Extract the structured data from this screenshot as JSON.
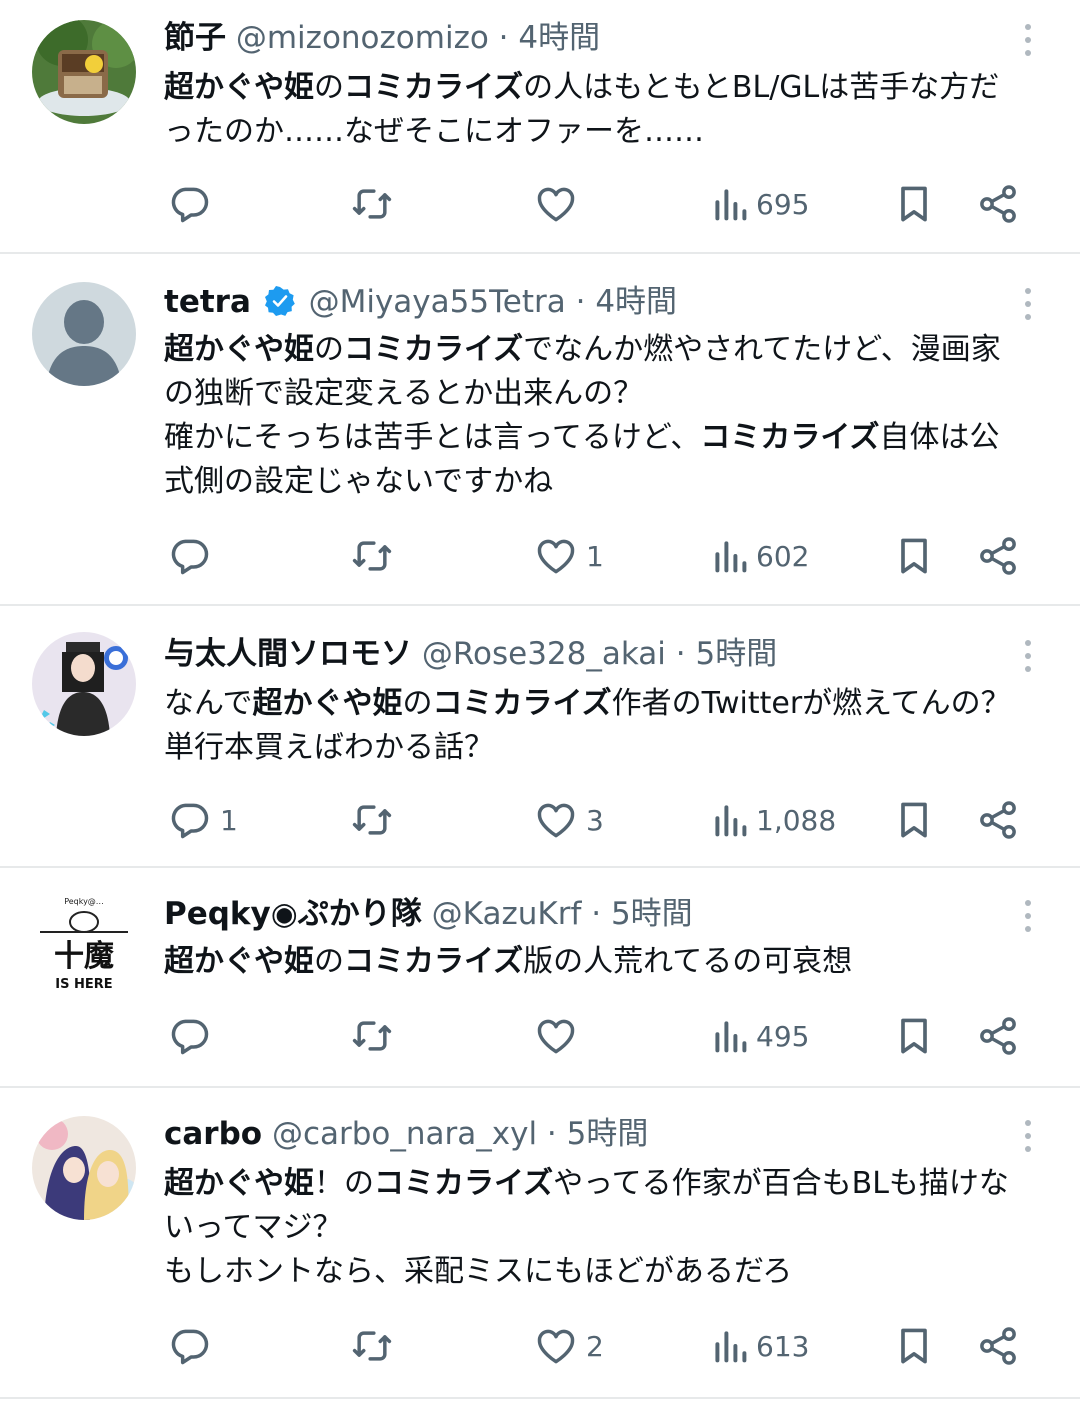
{
  "tweets": [
    {
      "name": "節子",
      "handle": "@mizonozomizo",
      "sep": "·",
      "time": "4時間",
      "lines": [
        [
          {
            "b": "超かぐや姫"
          },
          {
            "t": "の"
          },
          {
            "b": "コミカライズ"
          },
          {
            "t": "の人はもともとBL/GLは苦手な方だ"
          }
        ],
        [
          {
            "t": "ったのか……なぜそこにオファーを……"
          }
        ]
      ],
      "replies": "",
      "retweets": "",
      "likes": "",
      "views": "695"
    },
    {
      "name": "tetra",
      "verified": true,
      "handle": "@Miyaya55Tetra",
      "sep": "·",
      "time": "4時間",
      "lines": [
        [
          {
            "b": "超かぐや姫"
          },
          {
            "t": "の"
          },
          {
            "b": "コミカライズ"
          },
          {
            "t": "でなんか燃やされてたけど、漫画家"
          }
        ],
        [
          {
            "t": "の独断で設定変えるとか出来んの？"
          }
        ],
        [
          {
            "t": "確かにそっちは苦手とは言ってるけど、"
          },
          {
            "b": "コミカライズ"
          },
          {
            "t": "自体は公"
          }
        ],
        [
          {
            "t": "式側の設定じゃないですかね"
          }
        ]
      ],
      "replies": "",
      "retweets": "",
      "likes": "1",
      "views": "602"
    },
    {
      "name": "与太人間ソロモソ",
      "handle": "@Rose328_akai",
      "sep": "·",
      "time": "5時間",
      "lines": [
        [
          {
            "t": "なんで"
          },
          {
            "b": "超かぐや姫"
          },
          {
            "t": "の"
          },
          {
            "b": "コミカライズ"
          },
          {
            "t": "作者のTwitterが燃えてんの？"
          }
        ],
        [
          {
            "t": "単行本買えばわかる話？"
          }
        ]
      ],
      "replies": "1",
      "retweets": "",
      "likes": "3",
      "views": "1,088"
    },
    {
      "name": "Peqky◉ぷかり隊",
      "handle": "@KazuKrf",
      "sep": "·",
      "time": "5時間",
      "avatar_text": {
        "top": "Peqky@…",
        "mid": "十魔",
        "bottom": "IS HERE"
      },
      "lines": [
        [
          {
            "b": "超かぐや姫"
          },
          {
            "t": "の"
          },
          {
            "b": "コミカライズ"
          },
          {
            "t": "版の人荒れてるの可哀想"
          }
        ]
      ],
      "replies": "",
      "retweets": "",
      "likes": "",
      "views": "495"
    },
    {
      "name": "carbo",
      "handle": "@carbo_nara_xyl",
      "sep": "·",
      "time": "5時間",
      "lines": [
        [
          {
            "b": "超かぐや姫"
          },
          {
            "t": "！の"
          },
          {
            "b": "コミカライズ"
          },
          {
            "t": "やってる作家が百合もBLも描けな"
          }
        ],
        [
          {
            "t": "いってマジ？"
          }
        ],
        [
          {
            "t": "もしホントなら、采配ミスにもほどがあるだろ"
          }
        ]
      ],
      "replies": "",
      "retweets": "",
      "likes": "2",
      "views": "613"
    }
  ],
  "icons": {
    "reply": "reply-icon",
    "retweet": "retweet-icon",
    "like": "heart-icon",
    "views": "views-icon",
    "bookmark": "bookmark-icon",
    "share": "share-icon",
    "more": "more-icon",
    "verified": "verified-badge-icon"
  },
  "colors": {
    "text": "#0f1419",
    "muted": "#536471",
    "divider": "#e7e9ea",
    "verified": "#1d9bf0"
  }
}
